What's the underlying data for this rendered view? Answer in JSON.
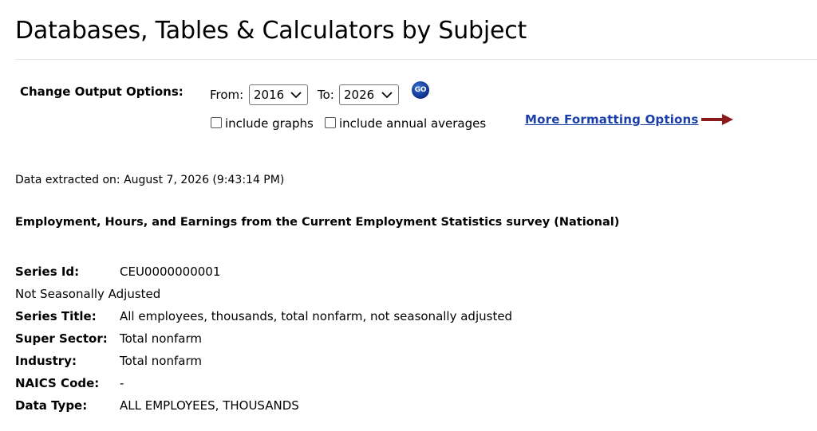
{
  "page": {
    "title": "Databases, Tables & Calculators by Subject"
  },
  "options": {
    "label": "Change Output Options:",
    "from_label": "From:",
    "from_value": "2016",
    "to_label": "To:",
    "to_value": "2026",
    "go_label": "GO",
    "include_graphs_label": "include graphs",
    "include_graphs_checked": false,
    "include_averages_label": "include annual averages",
    "include_averages_checked": false,
    "more_formatting_label": "More Formatting Options",
    "arrow_color": "#8b1a1a",
    "link_color": "#1a3fa8"
  },
  "extraction": {
    "text": "Data extracted on: August 7, 2026 (9:43:14 PM)"
  },
  "survey": {
    "title": "Employment, Hours, and Earnings from the Current Employment Statistics survey (National)"
  },
  "series": {
    "id_label": "Series Id:",
    "id_value": "CEU0000000001",
    "adjustment": "Not Seasonally Adjusted",
    "title_label": "Series Title:",
    "title_value": "All employees, thousands, total nonfarm, not seasonally adjusted",
    "super_sector_label": "Super Sector:",
    "super_sector_value": "Total nonfarm",
    "industry_label": "Industry:",
    "industry_value": "Total nonfarm",
    "naics_label": "NAICS Code:",
    "naics_value": "-",
    "data_type_label": "Data Type:",
    "data_type_value": "ALL EMPLOYEES, THOUSANDS"
  }
}
